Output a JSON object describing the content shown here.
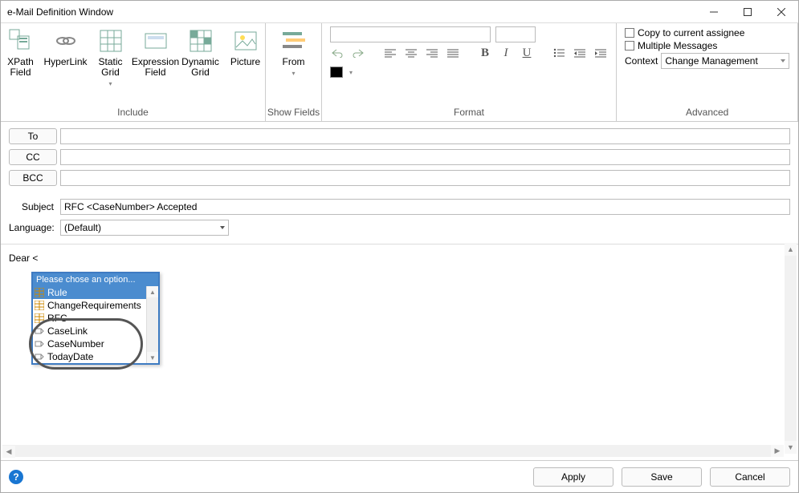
{
  "window": {
    "title": "e-Mail Definition Window"
  },
  "ribbon": {
    "include": {
      "label": "Include",
      "items": {
        "xpath": "XPath Field",
        "hyperlink": "HyperLink",
        "staticgrid": "Static Grid",
        "exprfield": "Expression Field",
        "dyngrid": "Dynamic Grid",
        "picture": "Picture"
      }
    },
    "showfields": {
      "label": "Show Fields",
      "from": "From"
    },
    "format": {
      "label": "Format"
    },
    "advanced": {
      "label": "Advanced",
      "copy_assignee": "Copy to current assignee",
      "multi_msg": "Multiple Messages",
      "context_lbl": "Context",
      "context_val": "Change Management"
    }
  },
  "recipients": {
    "to": "To",
    "cc": "CC",
    "bcc": "BCC"
  },
  "subject": {
    "label": "Subject",
    "value": "RFC <CaseNumber> Accepted"
  },
  "language": {
    "label": "Language:",
    "value": "(Default)"
  },
  "editor": {
    "greeting": "Dear <"
  },
  "autocomplete": {
    "hint": "Please chose an option...",
    "items": [
      "Rule",
      "ChangeRequirements",
      "RFC",
      "CaseLink",
      "CaseNumber",
      "TodayDate"
    ]
  },
  "buttons": {
    "apply": "Apply",
    "save": "Save",
    "cancel": "Cancel"
  }
}
